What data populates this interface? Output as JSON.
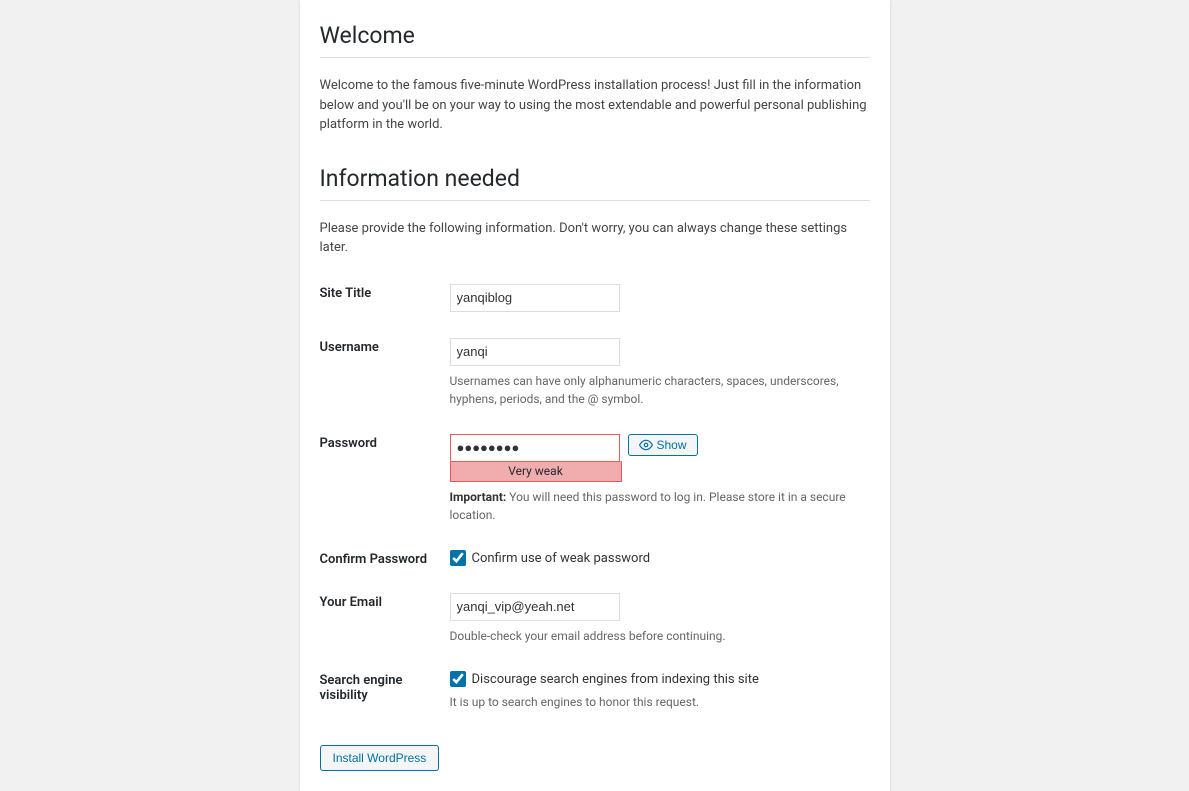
{
  "headings": {
    "welcome": "Welcome",
    "info_needed": "Information needed"
  },
  "paragraphs": {
    "welcome_intro": "Welcome to the famous five-minute WordPress installation process! Just fill in the information below and you'll be on your way to using the most extendable and powerful personal publishing platform in the world.",
    "info_intro": "Please provide the following information. Don't worry, you can always change these settings later."
  },
  "labels": {
    "site_title": "Site Title",
    "username": "Username",
    "password": "Password",
    "confirm_password": "Confirm Password",
    "your_email": "Your Email",
    "search_visibility": "Search engine visibility"
  },
  "values": {
    "site_title": "yanqiblog",
    "username": "yanqi",
    "password_masked": "●●●●●●●●",
    "email": "yanqi_vip@yeah.net"
  },
  "hints": {
    "username": "Usernames can have only alphanumeric characters, spaces, underscores, hyphens, periods, and the @ symbol.",
    "password_strength": "Very weak",
    "password_important_prefix": "Important:",
    "password_important": " You will need this password to log in. Please store it in a secure location.",
    "email": "Double-check your email address before continuing.",
    "search": "It is up to search engines to honor this request."
  },
  "checkbox_labels": {
    "confirm_weak": "Confirm use of weak password",
    "discourage": "Discourage search engines from indexing this site"
  },
  "buttons": {
    "show": "Show",
    "install": "Install WordPress"
  },
  "checked": {
    "confirm_weak": true,
    "discourage": true
  }
}
